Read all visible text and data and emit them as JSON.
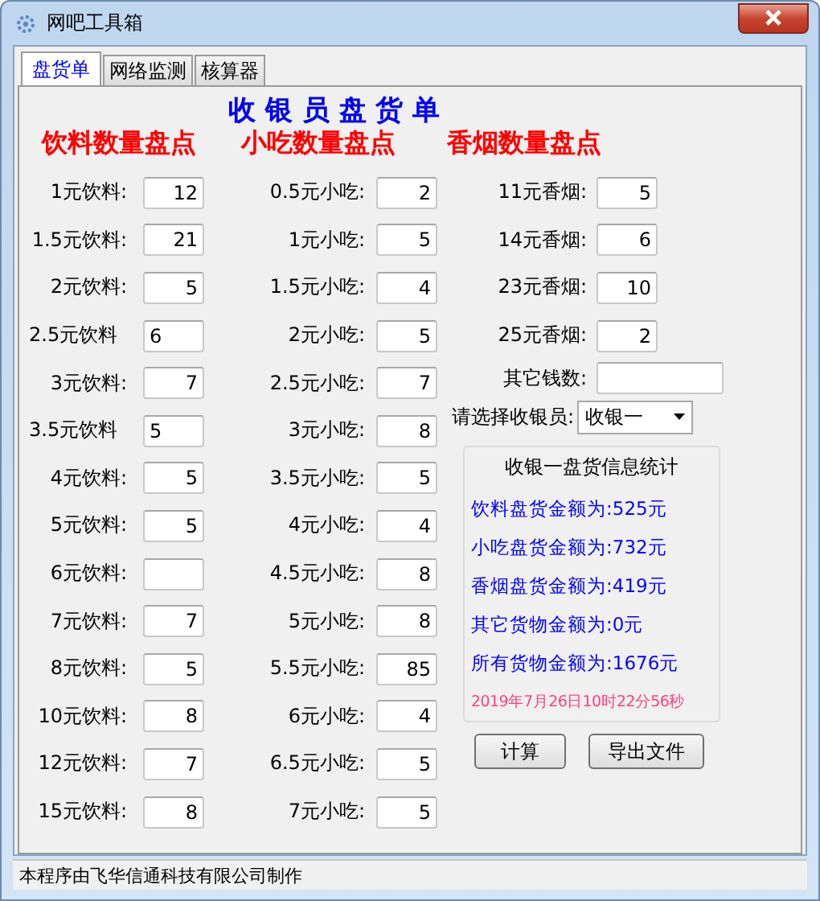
{
  "window": {
    "title": "网吧工具箱"
  },
  "tabs": [
    {
      "label": "盘货单",
      "selected": true
    },
    {
      "label": "网络监测",
      "selected": false
    },
    {
      "label": "核算器",
      "selected": false
    }
  ],
  "heading": "收 银 员 盘 货 单",
  "section_titles": [
    "饮料数量盘点",
    "小吃数量盘点",
    "香烟数量盘点"
  ],
  "drinks": [
    {
      "label": "1元饮料:",
      "value": "12",
      "kind": "right"
    },
    {
      "label": "1.5元饮料:",
      "value": "21",
      "kind": "right"
    },
    {
      "label": "2元饮料:",
      "value": "5",
      "kind": "right"
    },
    {
      "label": "2.5元饮料",
      "value": "6",
      "kind": "left"
    },
    {
      "label": "3元饮料:",
      "value": "7",
      "kind": "right"
    },
    {
      "label": "3.5元饮料",
      "value": "5",
      "kind": "left"
    },
    {
      "label": "4元饮料:",
      "value": "5",
      "kind": "right"
    },
    {
      "label": "5元饮料:",
      "value": "5",
      "kind": "right"
    },
    {
      "label": "6元饮料:",
      "kind": "right"
    },
    {
      "label": "7元饮料:",
      "value": "7",
      "kind": "right"
    },
    {
      "label": "8元饮料:",
      "value": "5",
      "kind": "right"
    },
    {
      "label": "10元饮料:",
      "value": "8",
      "kind": "right"
    },
    {
      "label": "12元饮料:",
      "value": "7",
      "kind": "right"
    },
    {
      "label": "15元饮料:",
      "value": "8",
      "kind": "right"
    }
  ],
  "snacks": [
    {
      "label": "0.5元小吃:",
      "value": "2"
    },
    {
      "label": "1元小吃:",
      "value": "5"
    },
    {
      "label": "1.5元小吃:",
      "value": "4"
    },
    {
      "label": "2元小吃:",
      "value": "5"
    },
    {
      "label": "2.5元小吃:",
      "value": "7"
    },
    {
      "label": "3元小吃:",
      "value": "8"
    },
    {
      "label": "3.5元小吃:",
      "value": "5"
    },
    {
      "label": "4元小吃:",
      "value": "4"
    },
    {
      "label": "4.5元小吃:",
      "value": "8"
    },
    {
      "label": "5元小吃:",
      "value": "8"
    },
    {
      "label": "5.5元小吃:",
      "value": "85"
    },
    {
      "label": "6元小吃:",
      "value": "4"
    },
    {
      "label": "6.5元小吃:",
      "value": "5"
    },
    {
      "label": "7元小吃:",
      "value": "5"
    }
  ],
  "cigarettes": [
    {
      "label": "11元香烟:",
      "value": "5"
    },
    {
      "label": "14元香烟:",
      "value": "6"
    },
    {
      "label": "23元香烟:",
      "value": "10"
    },
    {
      "label": "25元香烟:",
      "value": "2"
    }
  ],
  "other_money": {
    "label": "其它钱数:"
  },
  "cashier": {
    "label": "请选择收银员:",
    "value": "收银一"
  },
  "stats": {
    "title": "收银一盘货信息统计",
    "lines": [
      "饮料盘货金额为:525元",
      "小吃盘货金额为:732元",
      "香烟盘货金额为:419元",
      "其它货物金额为:0元",
      "所有货物金额为:1676元"
    ],
    "timestamp": "2019年7月26日10时22分56秒"
  },
  "buttons": [
    "计算",
    "导出文件"
  ],
  "status_bar": "本程序由飞华信通科技有限公司制作"
}
